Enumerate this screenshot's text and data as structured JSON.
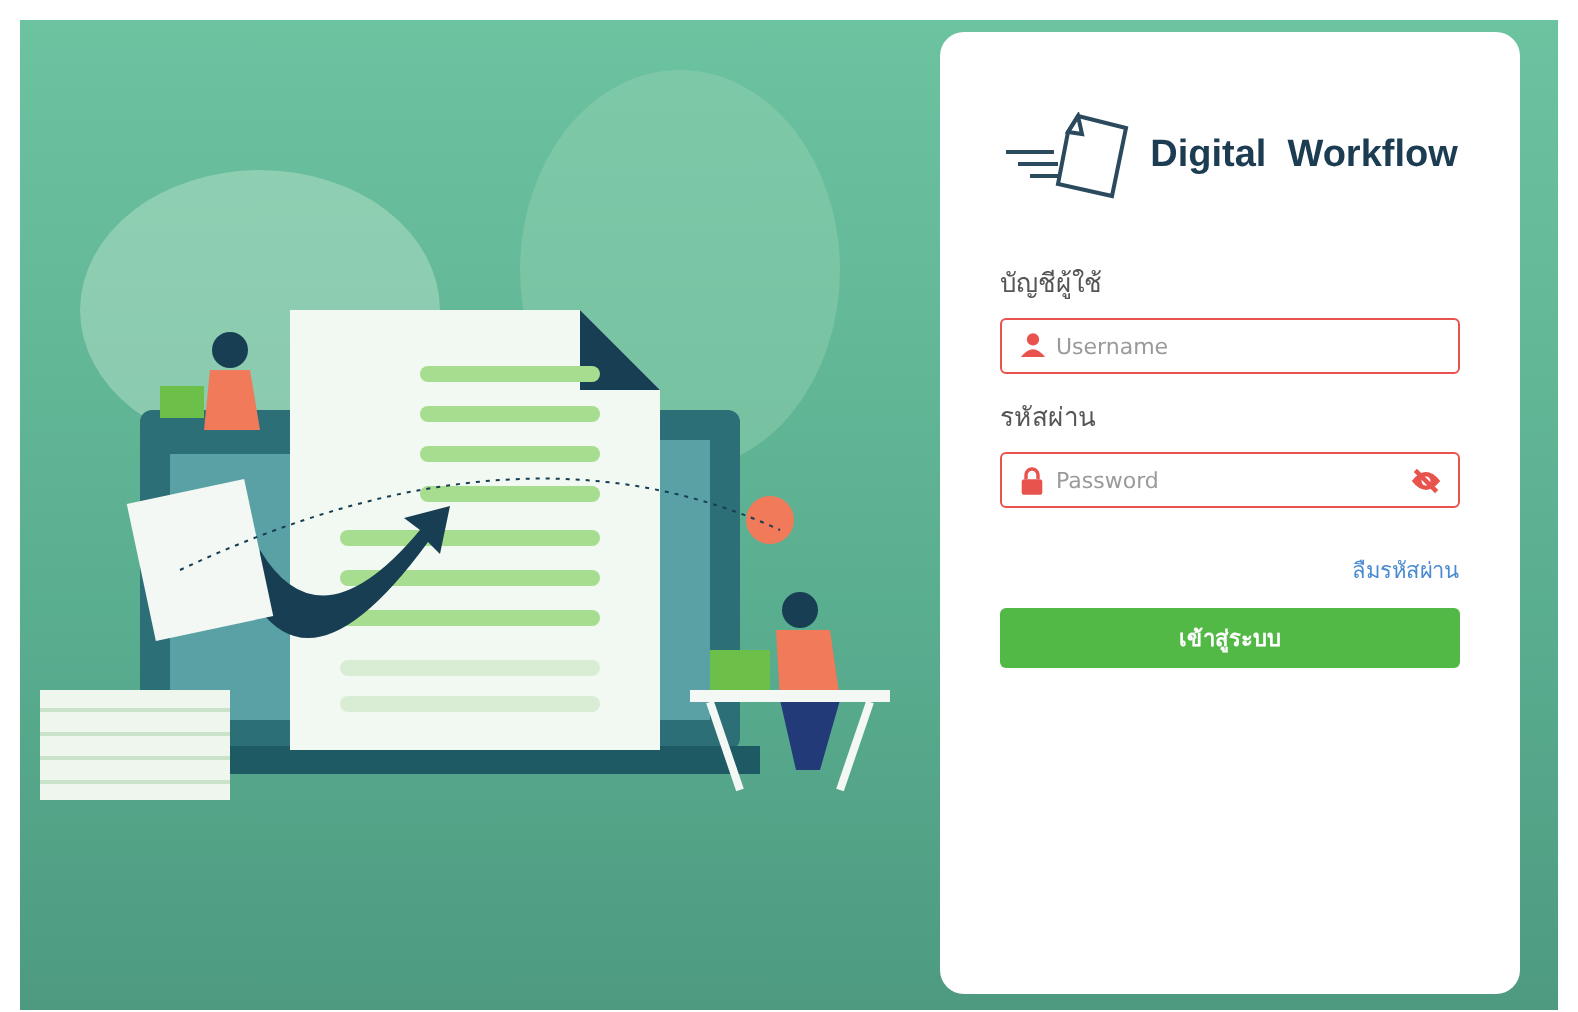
{
  "logo": {
    "text": "Digital  Workflow"
  },
  "login": {
    "fields": [
      {
        "label": "บัญชีผู้ใช้",
        "placeholder": "Username",
        "kind": "user",
        "invalid": true
      },
      {
        "label": "รหัสผ่าน",
        "placeholder": "Password",
        "kind": "password",
        "invalid": true,
        "masked": true
      }
    ],
    "forgot_link": "ลืมรหัสผ่าน",
    "submit_button": "เข้าสู่ระบบ"
  }
}
